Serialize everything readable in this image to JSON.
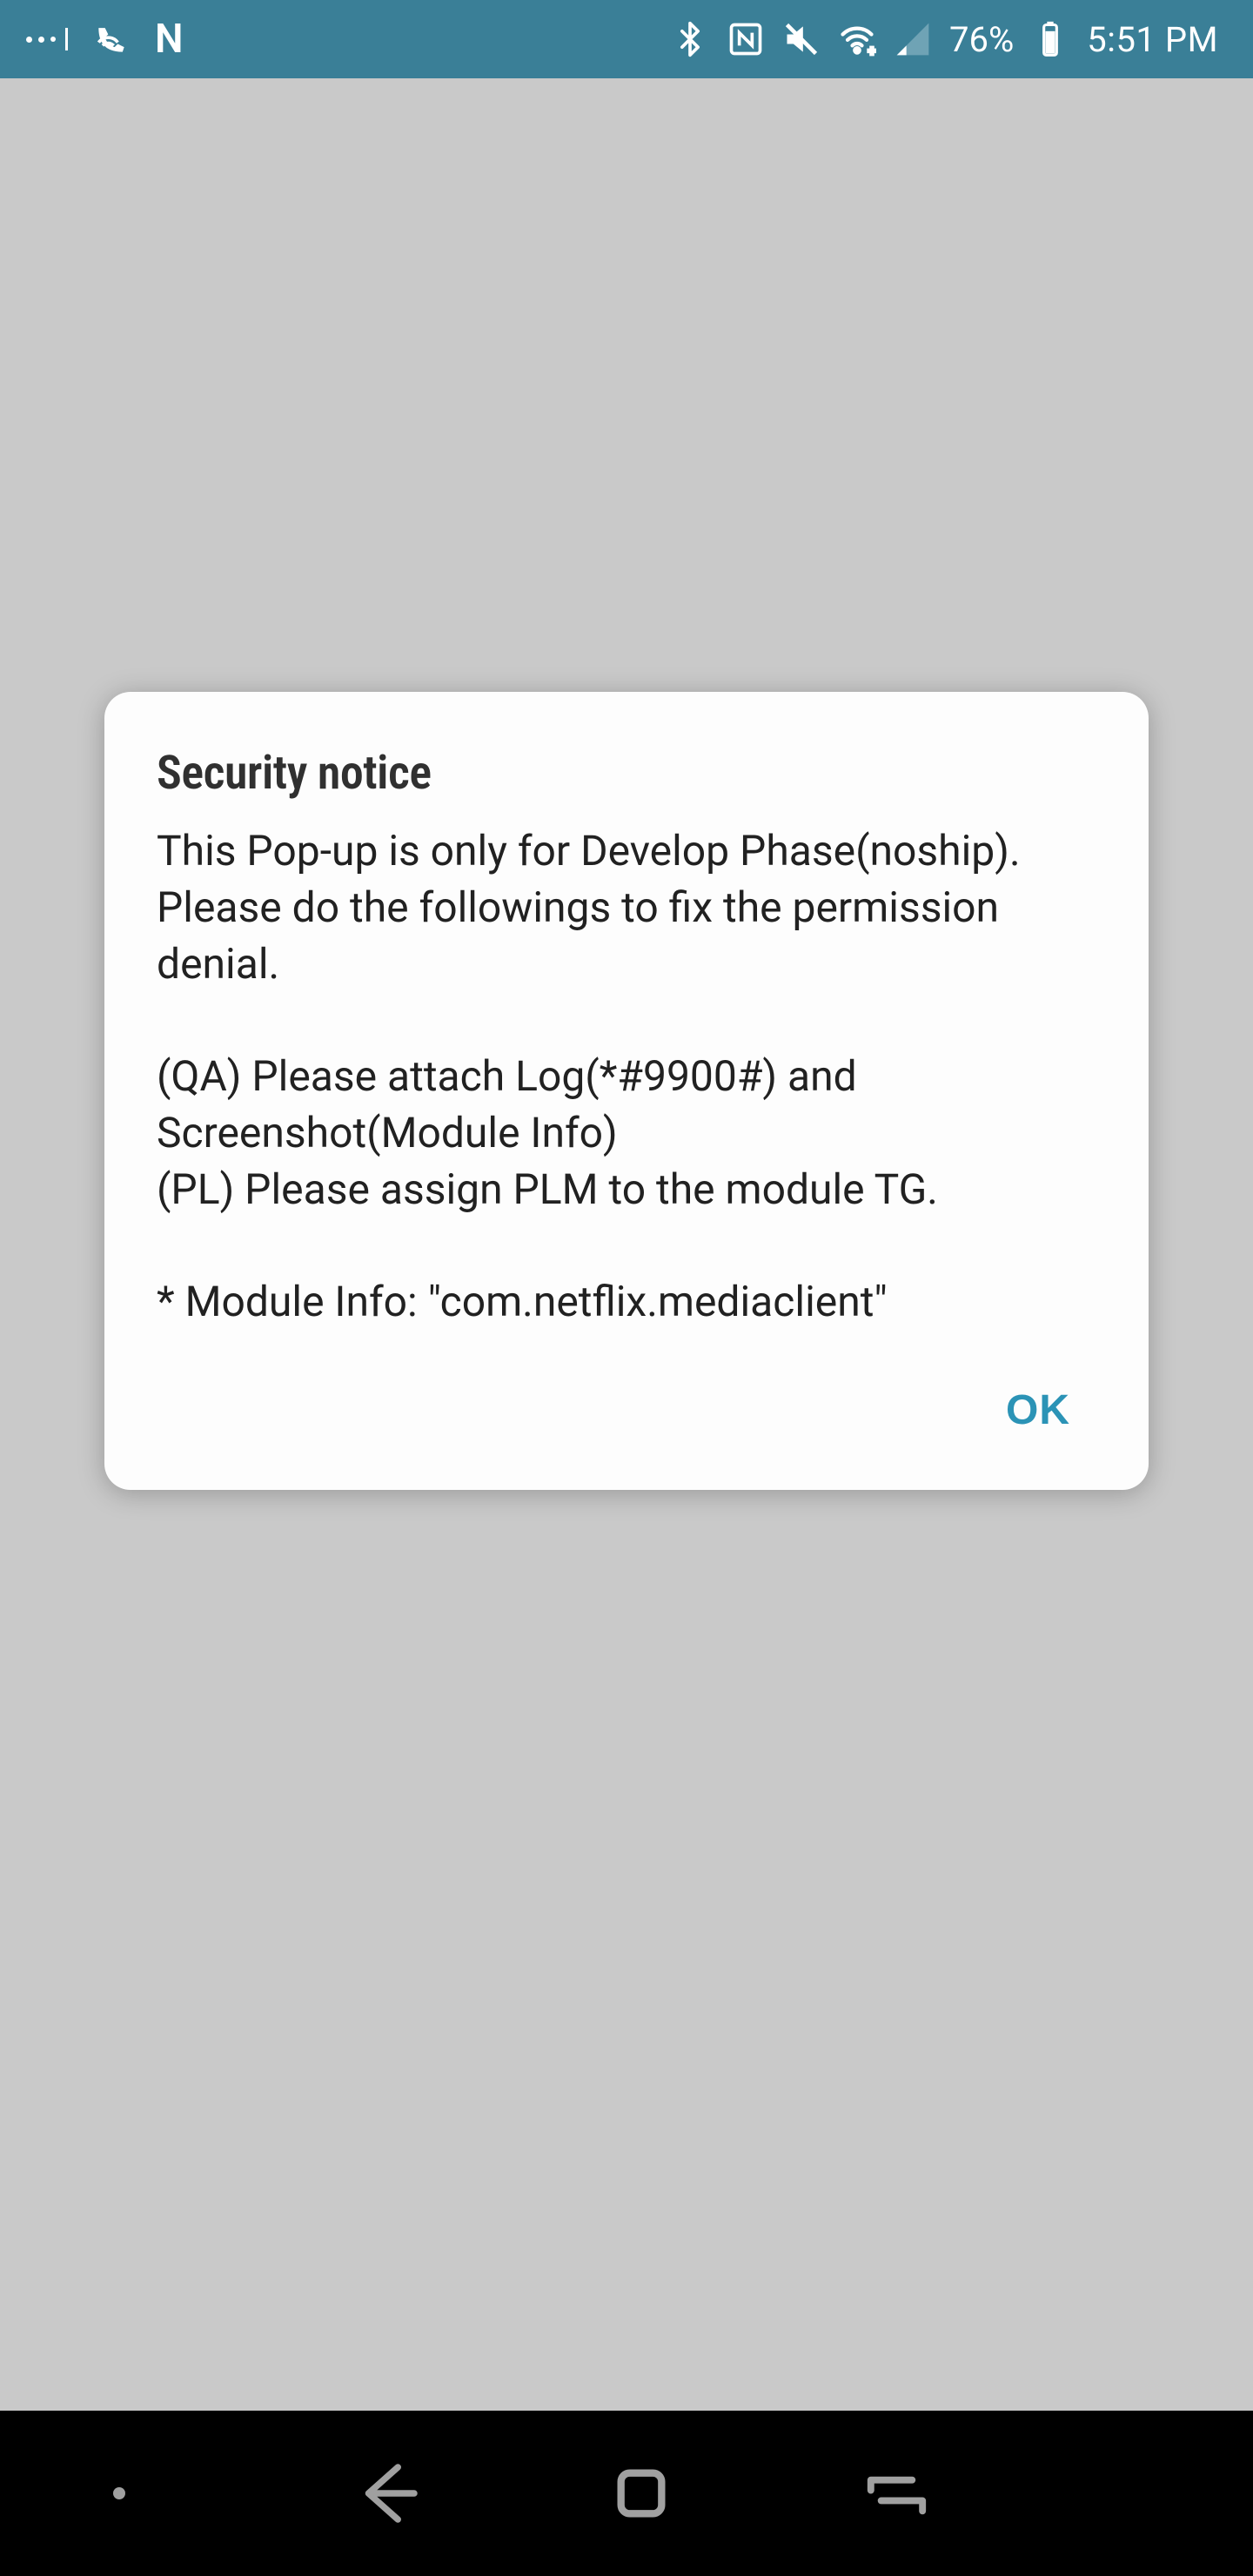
{
  "status_bar": {
    "n_label": "N",
    "battery_percent": "76%",
    "time": "5:51 PM"
  },
  "dialog": {
    "title": "Security notice",
    "body": "This Pop-up is only for Develop Phase(noship).\nPlease do the followings to fix the permission denial.\n\n(QA) Please attach Log(*#9900#) and Screenshot(Module Info)\n(PL) Please assign PLM to the module TG.\n\n* Module Info: \"com.netflix.mediaclient\"",
    "ok_label": "OK"
  }
}
